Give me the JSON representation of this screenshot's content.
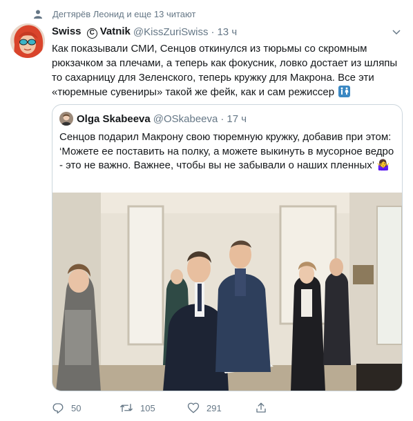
{
  "social_context": {
    "text": "Дегтярёв Леонид и еще 13 читают",
    "icon": "person-icon"
  },
  "tweet": {
    "name_part1": "Swiss",
    "copyright_symbol": "C",
    "name_part2": "Vatnik",
    "handle": "@KissZuriSwiss",
    "dot": "·",
    "time": "13 ч",
    "text": "Как показывали СМИ, Сенцов откинулся из тюрьмы со скромным рюкзачком за плечами, а теперь как фокусник, ловко достает из шляпы то сахарницу для Зеленского, теперь кружку для Макрона. Все эти «тюремные сувениры» такой же фейк, как и сам режиссер",
    "emoji": "restroom-sign-emoji"
  },
  "quoted": {
    "name": "Olga Skabeeva",
    "handle": "@OSkabeeva",
    "dot": "·",
    "time": "17 ч",
    "text": "Сенцов подарил Макрону свою тюремную кружку, добавив при этом: ‘Можете ее поставить на полку, а можете выкинуть в мусорное ведро - это не важно. Важнее, чтобы вы не забывали о наших пленных’ 🤷‍♀️"
  },
  "actions": {
    "reply_count": "50",
    "retweet_count": "105",
    "like_count": "291"
  },
  "colors": {
    "text": "#14171a",
    "secondary": "#657786",
    "border": "#ccd6dd",
    "accent_emoji": "#3b88c3"
  }
}
